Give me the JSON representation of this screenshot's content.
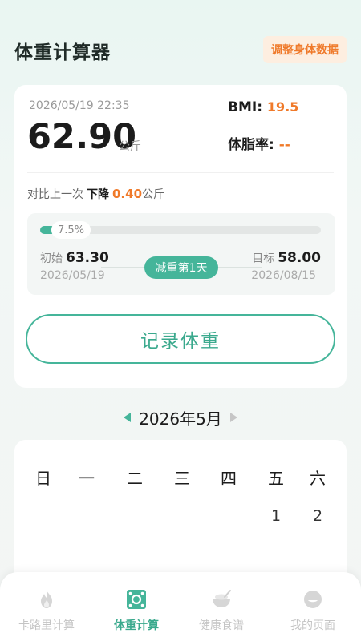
{
  "header": {
    "title": "体重计算器",
    "adjust_button": "调整身体数据"
  },
  "summary": {
    "datetime": "2026/05/19 22:35",
    "weight": "62.90",
    "unit": "公斤",
    "bmi_label": "BMI:",
    "bmi_value": "19.5",
    "body_fat_label": "体脂率:",
    "body_fat_value": "--",
    "compare_label": "对比上一次",
    "compare_direction": "下降",
    "compare_amount": "0.40",
    "compare_unit": "公斤"
  },
  "progress": {
    "percent_label": "7.5%",
    "fraction": 0.075,
    "start_label": "初始",
    "start_weight": "63.30",
    "start_date": "2026/05/19",
    "goal_label": "目标",
    "goal_weight": "58.00",
    "goal_date": "2026/08/15",
    "day_badge": "减重第1天"
  },
  "record_button": "记录体重",
  "calendar": {
    "month_label": "2026年5月",
    "weekdays": [
      "日",
      "一",
      "二",
      "三",
      "四",
      "五",
      "六"
    ],
    "first_row_days": [
      "1",
      "2"
    ]
  },
  "tabbar": {
    "tabs": [
      {
        "label": "卡路里计算",
        "icon": "flame-icon",
        "active": false
      },
      {
        "label": "体重计算",
        "icon": "scale-icon",
        "active": true
      },
      {
        "label": "健康食谱",
        "icon": "bowl-icon",
        "active": false
      },
      {
        "label": "我的页面",
        "icon": "profile-icon",
        "active": false
      }
    ]
  },
  "colors": {
    "accent": "#45b59a",
    "orange": "#f07a2a",
    "inactive": "#c4c4c4"
  }
}
